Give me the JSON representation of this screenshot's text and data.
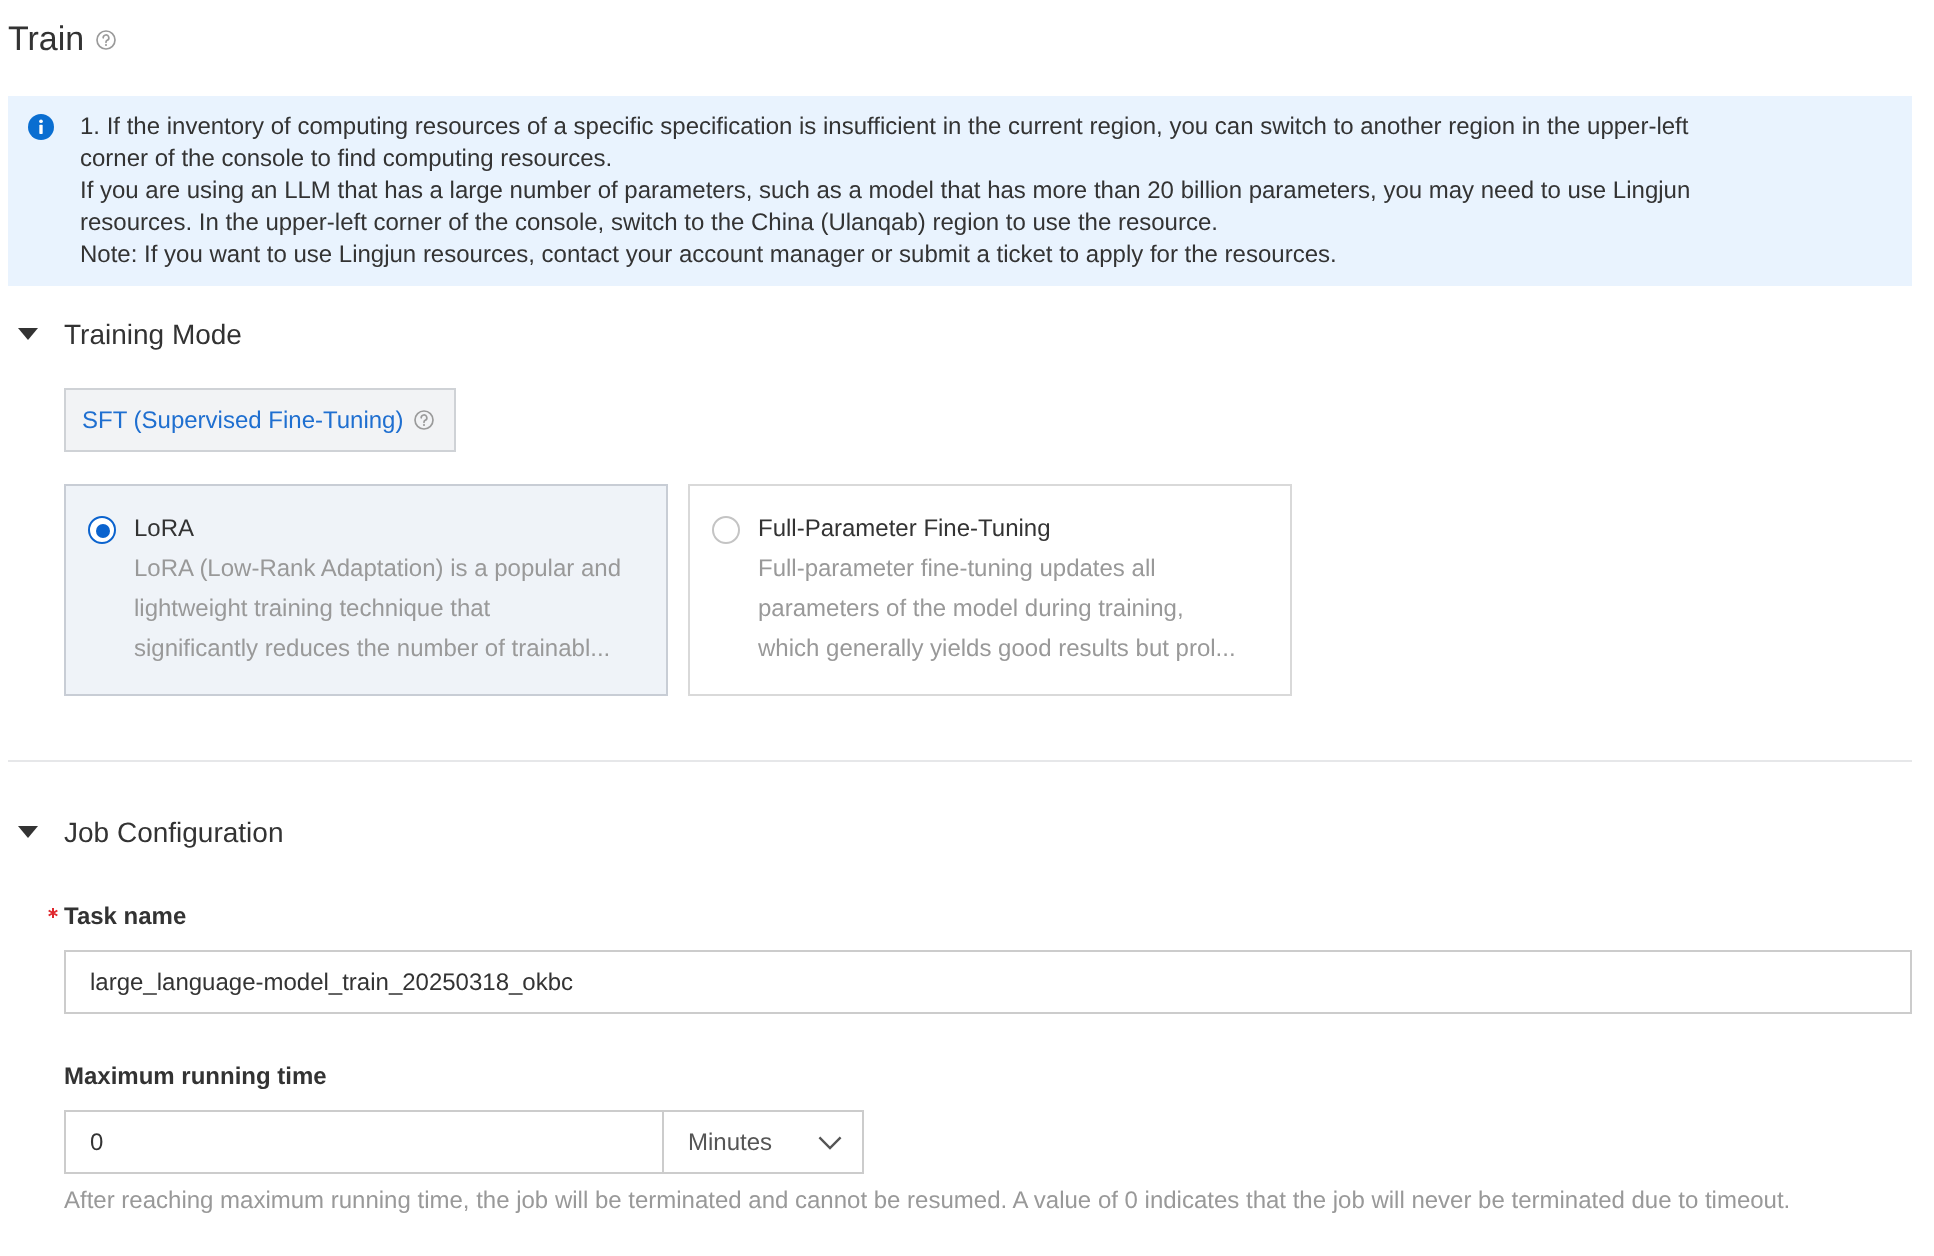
{
  "title": "Train",
  "alert": {
    "paragraphs": [
      {
        "lines": [
          "1. If the inventory of computing resources of a specific specification is insufficient in the current region, you can switch to another region in the upper-left",
          "corner of the console to find computing resources."
        ]
      },
      {
        "lines": [
          "If you are using an LLM that has a large number of parameters, such as a model that has more than 20 billion parameters, you may need to use Lingjun",
          "resources. In the upper-left corner of the console, switch to the China (Ulanqab) region to use the resource."
        ]
      },
      {
        "lines": [
          "Note: If you want to use Lingjun resources, contact your account manager or submit a ticket to apply for the resources."
        ]
      }
    ]
  },
  "sections": [
    {
      "kind": "training_mode",
      "title": "Training Mode",
      "expanded": true,
      "tabs": [
        {
          "label": "SFT (Supervised Fine-Tuning)",
          "selected": true
        }
      ],
      "options": [
        {
          "title": "LoRA",
          "description_lines": [
            "LoRA (Low-Rank Adaptation) is a popular and",
            "lightweight training technique that",
            "significantly reduces the number of trainabl..."
          ],
          "selected": true
        },
        {
          "title": "Full-Parameter Fine-Tuning",
          "description_lines": [
            "Full-parameter fine-tuning updates all",
            "parameters of the model during training,",
            "which generally yields good results but prol..."
          ],
          "selected": false
        }
      ]
    },
    {
      "kind": "job_configuration",
      "title": "Job Configuration",
      "expanded": true,
      "fields": [
        {
          "kind": "text",
          "label": "Task name",
          "required": true,
          "value": "large_language-model_train_20250318_okbc"
        },
        {
          "kind": "duration",
          "label": "Maximum running time",
          "required": false,
          "value": "0",
          "unit": "Minutes",
          "help": "After reaching maximum running time, the job will be terminated and cannot be resumed. A value of 0 indicates that the job will never be terminated due to timeout."
        }
      ]
    }
  ]
}
